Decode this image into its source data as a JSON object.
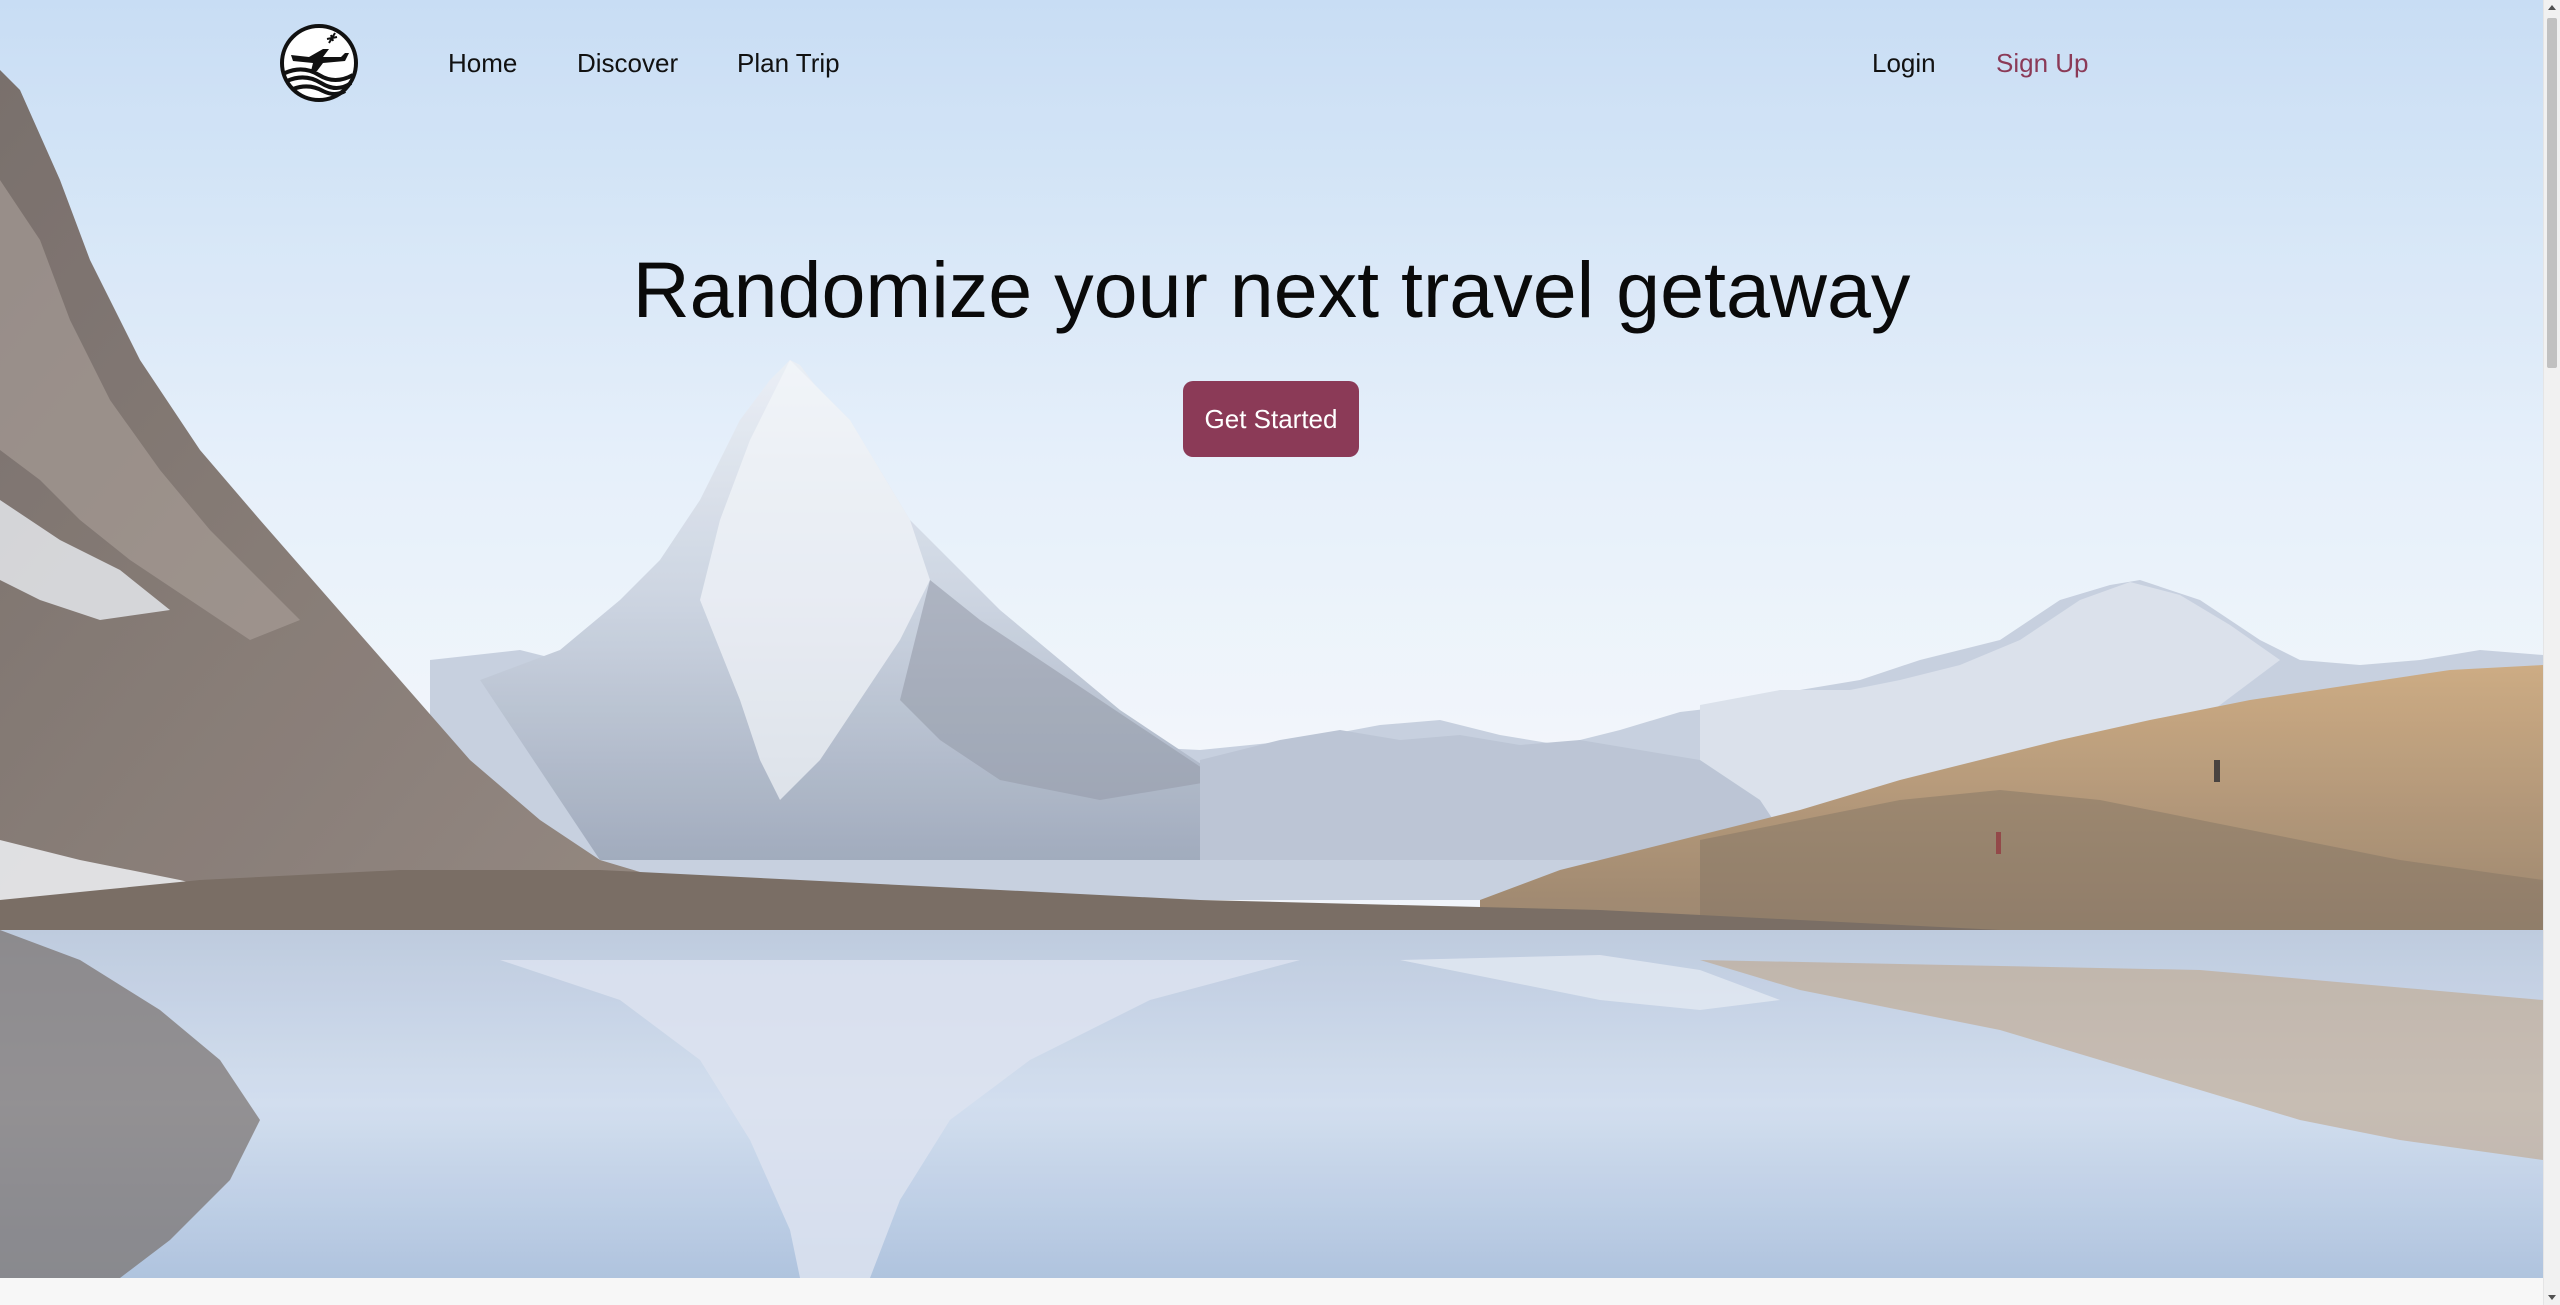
{
  "nav": {
    "logo_icon": "plane-globe-logo-icon",
    "links": [
      {
        "label": "Home"
      },
      {
        "label": "Discover"
      },
      {
        "label": "Plan Trip"
      }
    ],
    "login_label": "Login",
    "signup_label": "Sign Up"
  },
  "hero": {
    "title": "Randomize your next travel getaway",
    "cta_label": "Get Started",
    "background": "mountain-lake-landscape-image"
  },
  "colors": {
    "accent": "#8b3a57",
    "text": "#111111",
    "button_text": "#ffffff"
  }
}
